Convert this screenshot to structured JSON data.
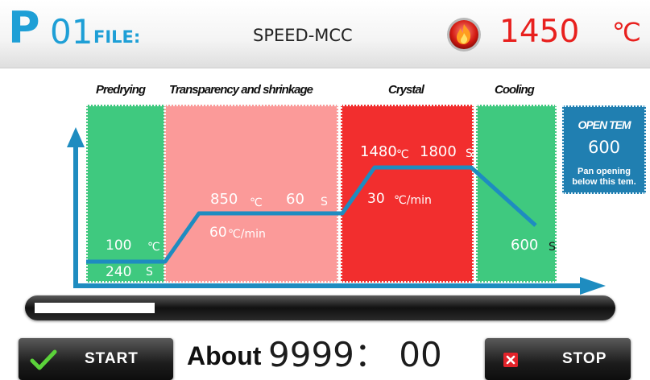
{
  "header": {
    "program_letter": "P",
    "program_number": "01",
    "file_label": "FILE:",
    "file_name": "SPEED-MCC",
    "fire_icon": "flame-icon",
    "current_temp": "1450",
    "temp_unit": "℃"
  },
  "stages": [
    {
      "title": "Predrying",
      "color": "#3fc97f"
    },
    {
      "title": "Transparency and shrinkage",
      "color": "#fb9a99"
    },
    {
      "title": "Crystal",
      "color": "#f22e2e"
    },
    {
      "title": "Cooling",
      "color": "#3fc97f"
    }
  ],
  "profile": {
    "predrying": {
      "temp": "100",
      "temp_unit": "℃",
      "time": "240",
      "time_unit": "S"
    },
    "shrinkage": {
      "rate": "60",
      "rate_unit": "℃/min",
      "temp": "850",
      "temp_unit": "℃",
      "time": "60",
      "time_unit": "S"
    },
    "crystal": {
      "rate": "30",
      "rate_unit": "℃/min",
      "temp": "1480",
      "temp_unit": "℃",
      "time": "1800",
      "time_unit": "S"
    },
    "cooling": {
      "time": "600",
      "time_unit": "S"
    },
    "line_color": "#1e8cc0"
  },
  "open_temp": {
    "title": "OPEN TEM",
    "value": "600",
    "note": "Pan opening below this tem."
  },
  "progress": {
    "fraction": 0.21
  },
  "controls": {
    "start_label": "START",
    "stop_label": "STOP",
    "about_label": "About",
    "remaining_time": "9999： 00"
  },
  "colors": {
    "accent": "#1e9fd6",
    "temp_red": "#e8201e",
    "open_box": "#207fb1"
  }
}
